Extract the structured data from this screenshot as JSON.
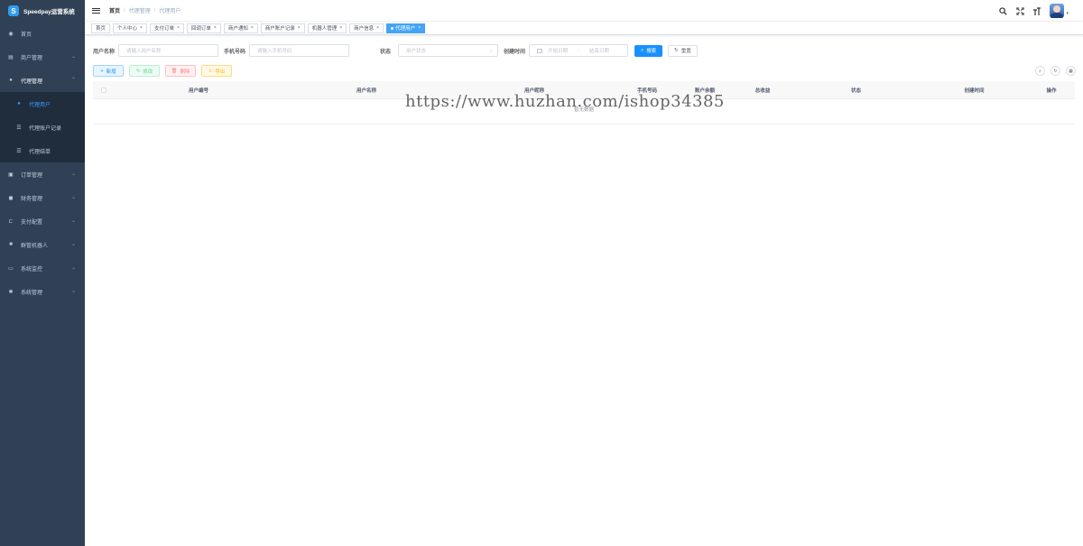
{
  "brand": {
    "title": "Speedpay运营系统"
  },
  "sidebar": {
    "items": [
      {
        "label": "首页",
        "icon": "dashboard-icon"
      },
      {
        "label": "商户管理",
        "icon": "merchant-icon"
      },
      {
        "label": "代理管理",
        "icon": "agent-icon"
      },
      {
        "label": "订单管理",
        "icon": "order-icon"
      },
      {
        "label": "财务管理",
        "icon": "finance-icon"
      },
      {
        "label": "支付配置",
        "icon": "payment-config-icon"
      },
      {
        "label": "群管机器人",
        "icon": "robot-icon"
      },
      {
        "label": "系统监控",
        "icon": "monitor-icon"
      },
      {
        "label": "系统管理",
        "icon": "settings-icon"
      }
    ],
    "agent_submenu": [
      {
        "label": "代理用户",
        "icon": "user-icon"
      },
      {
        "label": "代理账户记录",
        "icon": "list-icon"
      },
      {
        "label": "代理结单",
        "icon": "list-icon"
      }
    ]
  },
  "breadcrumb": {
    "home": "首页",
    "section": "代理管理",
    "current": "代理用户"
  },
  "tags": [
    {
      "label": "首页"
    },
    {
      "label": "个人中心"
    },
    {
      "label": "支付订单"
    },
    {
      "label": "回调订单"
    },
    {
      "label": "商户通知"
    },
    {
      "label": "商户账户记录"
    },
    {
      "label": "机器人管理"
    },
    {
      "label": "商户信息"
    },
    {
      "label": "代理用户"
    }
  ],
  "search": {
    "username_label": "用户名称",
    "username_placeholder": "请输入用户名称",
    "phone_label": "手机号码",
    "phone_placeholder": "请输入手机号码",
    "status_label": "状态",
    "status_placeholder": "用户状态",
    "created_label": "创建时间",
    "start_placeholder": "开始日期",
    "range_sep": "-",
    "end_placeholder": "结束日期",
    "search_button": "搜索",
    "reset_button": "重置"
  },
  "toolbar": {
    "add": "新增",
    "edit": "修改",
    "delete": "删除",
    "export": "导出"
  },
  "table": {
    "columns": [
      "用户编号",
      "用户名称",
      "用户昵称",
      "手机号码",
      "账户余额",
      "总收益",
      "状态",
      "创建时间",
      "操作"
    ],
    "empty_text": "暂无数据"
  },
  "watermark": "https://www.huzhan.com/ishop34385",
  "colors": {
    "sidebar_bg": "#304156",
    "primary": "#1890ff",
    "active_tag": "#42a5f5"
  }
}
